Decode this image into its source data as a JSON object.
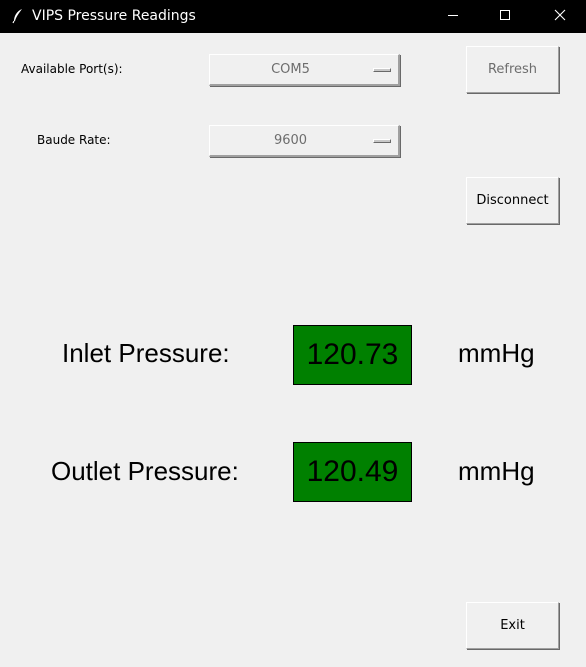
{
  "window": {
    "title": "VIPS Pressure Readings",
    "icon": "feather-icon",
    "controls": [
      "minimize-icon",
      "maximize-icon",
      "close-icon"
    ]
  },
  "connection": {
    "port_label": "Available Port(s):",
    "port_value": "COM5",
    "baud_label": "Baude Rate:",
    "baud_value": "9600",
    "refresh_label": "Refresh",
    "disconnect_label": "Disconnect"
  },
  "readings": {
    "inlet": {
      "label": "Inlet Pressure:",
      "value": "120.73",
      "unit": "mmHg"
    },
    "outlet": {
      "label": "Outlet Pressure:",
      "value": "120.49",
      "unit": "mmHg"
    },
    "display_color": "#008000"
  },
  "footer": {
    "exit_label": "Exit"
  }
}
